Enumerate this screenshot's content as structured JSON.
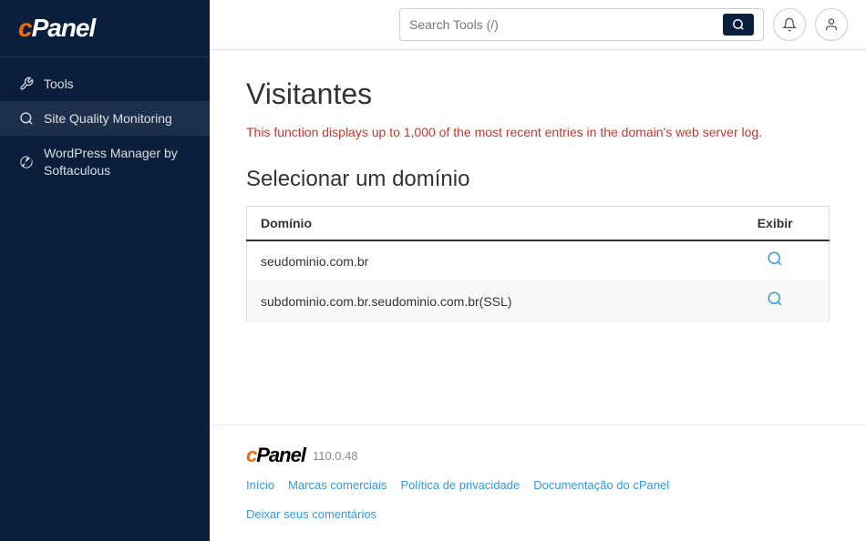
{
  "sidebar": {
    "logo": "cPanel",
    "items": [
      {
        "id": "tools",
        "label": "Tools",
        "icon": "wrench"
      },
      {
        "id": "site-quality",
        "label": "Site Quality Monitoring",
        "icon": "search"
      },
      {
        "id": "wordpress-manager",
        "label": "WordPress Manager by Softaculous",
        "icon": "wordpress"
      }
    ]
  },
  "header": {
    "search_placeholder": "Search Tools (/)",
    "search_value": ""
  },
  "main": {
    "page_title": "Visitantes",
    "description": "This function displays up to 1,000 of the most recent entries in the domain's web server log.",
    "section_title": "Selecionar um domínio",
    "table": {
      "columns": [
        "Domínio",
        "Exibir"
      ],
      "rows": [
        {
          "domain": "seudominio.com.br",
          "has_link": true
        },
        {
          "domain": "subdominio.com.br.seudominio.com.br(SSL)",
          "has_link": true
        }
      ]
    }
  },
  "footer": {
    "logo": "cPanel",
    "version": "110.0.48",
    "links": [
      {
        "label": "Início",
        "url": "#"
      },
      {
        "label": "Marcas comerciais",
        "url": "#"
      },
      {
        "label": "Política de privacidade",
        "url": "#"
      },
      {
        "label": "Documentação do cPanel",
        "url": "#"
      }
    ],
    "comment_label": "Deixar seus comentários"
  }
}
